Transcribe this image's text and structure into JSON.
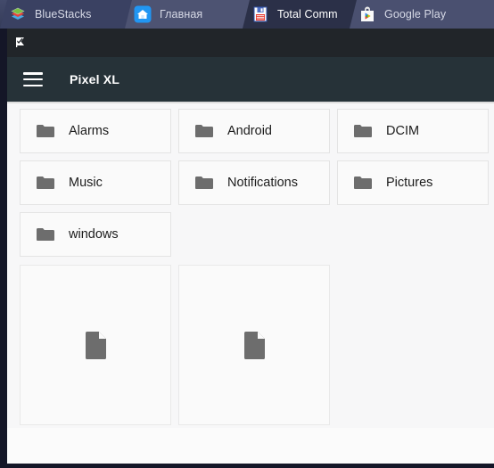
{
  "emulator": {
    "tabs": [
      {
        "label": "BlueStacks",
        "icon": "bluestacks-logo-icon",
        "active": false
      },
      {
        "label": "Главная",
        "icon": "home-icon",
        "active": false
      },
      {
        "label": "Total Comm",
        "icon": "floppy-disk-icon",
        "active": true
      },
      {
        "label": "Google Play",
        "icon": "google-play-icon",
        "active": false
      }
    ]
  },
  "statusbar": {
    "icon": "notification-flag-icon"
  },
  "appbar": {
    "menu_icon": "hamburger-menu-icon",
    "title": "Pixel XL"
  },
  "filegrid": {
    "folder_icon": "folder-icon",
    "file_icon": "document-file-icon",
    "folders": [
      [
        {
          "name": "Alarms"
        },
        {
          "name": "Android"
        },
        {
          "name": "DCIM"
        },
        {
          "name": ""
        }
      ],
      [
        {
          "name": "Music"
        },
        {
          "name": "Notifications"
        },
        {
          "name": "Pictures"
        },
        {
          "name": ""
        }
      ],
      [
        {
          "name": "windows"
        }
      ]
    ],
    "files": [
      {
        "name": ""
      },
      {
        "name": ""
      }
    ]
  },
  "colors": {
    "tabstrip": "#3a4160",
    "active_tab": "#2b3048",
    "statusbar": "#212529",
    "appbar": "#263238",
    "content_bg": "#f7f7f8",
    "card_bg": "#fafafa",
    "icon_gray": "#6d6d6d",
    "frame": "#141627"
  }
}
